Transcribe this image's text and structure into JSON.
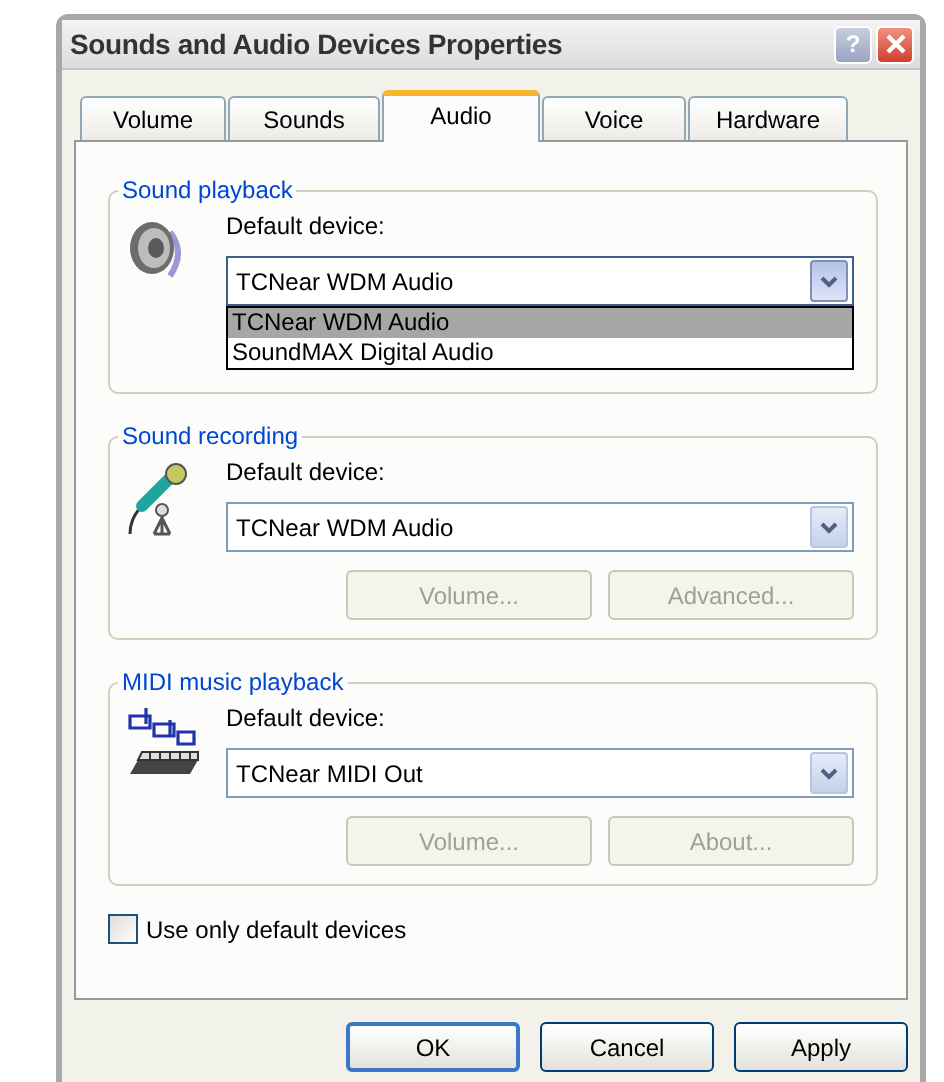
{
  "window": {
    "title": "Sounds and Audio Devices Properties",
    "help_label": "?"
  },
  "tabs": [
    {
      "label": "Volume",
      "selected": false
    },
    {
      "label": "Sounds",
      "selected": false
    },
    {
      "label": "Audio",
      "selected": true
    },
    {
      "label": "Voice",
      "selected": false
    },
    {
      "label": "Hardware",
      "selected": false
    }
  ],
  "groups": [
    {
      "title": "Sound playback",
      "kind": "speaker",
      "label": "Default device:",
      "value": "TCNear WDM Audio",
      "expanded": true,
      "options": [
        {
          "label": "TCNear WDM Audio",
          "selected": true
        },
        {
          "label": "SoundMAX Digital Audio",
          "selected": false
        }
      ]
    },
    {
      "title": "Sound recording",
      "kind": "microphone",
      "label": "Default device:",
      "value": "TCNear WDM Audio",
      "expanded": false,
      "buttons": [
        {
          "label": "Volume...",
          "disabled": true
        },
        {
          "label": "Advanced...",
          "disabled": true
        }
      ]
    },
    {
      "title": "MIDI music playback",
      "kind": "midi",
      "label": "Default device:",
      "value": "TCNear MIDI Out",
      "expanded": false,
      "buttons": [
        {
          "label": "Volume...",
          "disabled": true
        },
        {
          "label": "About...",
          "disabled": true
        }
      ]
    }
  ],
  "checkbox": {
    "label": "Use only default devices",
    "checked": false
  },
  "buttons": [
    {
      "label": "OK",
      "default": true
    },
    {
      "label": "Cancel",
      "default": false
    },
    {
      "label": "Apply",
      "default": false
    }
  ]
}
